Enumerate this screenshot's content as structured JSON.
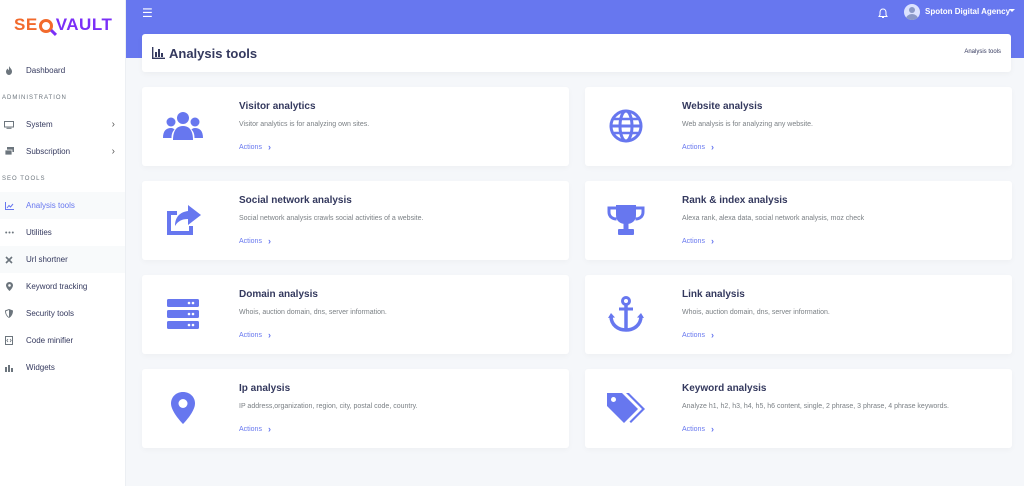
{
  "logo": {
    "part1": "SE",
    "part2": "VAULT"
  },
  "sidebar": {
    "items": [
      {
        "label": "Dashboard",
        "icon": "fire-icon"
      },
      {
        "header": "ADMINISTRATION"
      },
      {
        "label": "System",
        "icon": "monitor-icon",
        "chevron": "›"
      },
      {
        "label": "Subscription",
        "icon": "layers-icon",
        "chevron": "›"
      },
      {
        "header": "SEO TOOLS"
      },
      {
        "label": "Analysis tools",
        "icon": "chart-icon"
      },
      {
        "label": "Utilities",
        "icon": "ellipsis-icon"
      },
      {
        "label": "Url shortner",
        "icon": "cross-icon"
      },
      {
        "label": "Keyword tracking",
        "icon": "map-pin-icon"
      },
      {
        "label": "Security tools",
        "icon": "shield-icon"
      },
      {
        "label": "Code minifier",
        "icon": "code-file-icon"
      },
      {
        "label": "Widgets",
        "icon": "puzzle-icon"
      }
    ]
  },
  "navbar": {
    "menu_glyph": "☰",
    "user_name": "Spoton Digital Agency"
  },
  "page_header": {
    "title": "Analysis tools",
    "breadcrumb": "Analysis tools"
  },
  "cards": [
    {
      "title": "Visitor analytics",
      "desc": "Visitor analytics is for analyzing own sites.",
      "action": "Actions",
      "icon": "users-icon"
    },
    {
      "title": "Website analysis",
      "desc": "Web analysis is for analyzing any website.",
      "action": "Actions",
      "icon": "globe-icon"
    },
    {
      "title": "Social network analysis",
      "desc": "Social network analysis crawls social activities of a website.",
      "action": "Actions",
      "icon": "share-icon"
    },
    {
      "title": "Rank & index analysis",
      "desc": "Alexa rank, alexa data, social network analysis, moz check",
      "action": "Actions",
      "icon": "trophy-icon"
    },
    {
      "title": "Domain analysis",
      "desc": "Whois, auction domain, dns, server information.",
      "action": "Actions",
      "icon": "server-icon"
    },
    {
      "title": "Link analysis",
      "desc": "Whois, auction domain, dns, server information.",
      "action": "Actions",
      "icon": "anchor-icon"
    },
    {
      "title": "Ip analysis",
      "desc": "IP address,organization, region, city, postal code, country.",
      "action": "Actions",
      "icon": "location-icon"
    },
    {
      "title": "Keyword analysis",
      "desc": "Analyze h1, h2, h3, h4, h5, h6 content, single, 2 phrase, 3 phrase, 4 phrase keywords.",
      "action": "Actions",
      "icon": "tags-icon"
    }
  ],
  "colors": {
    "primary": "#6777ef",
    "logo_orange": "#f26a2c",
    "logo_purple": "#7b2ff7"
  }
}
